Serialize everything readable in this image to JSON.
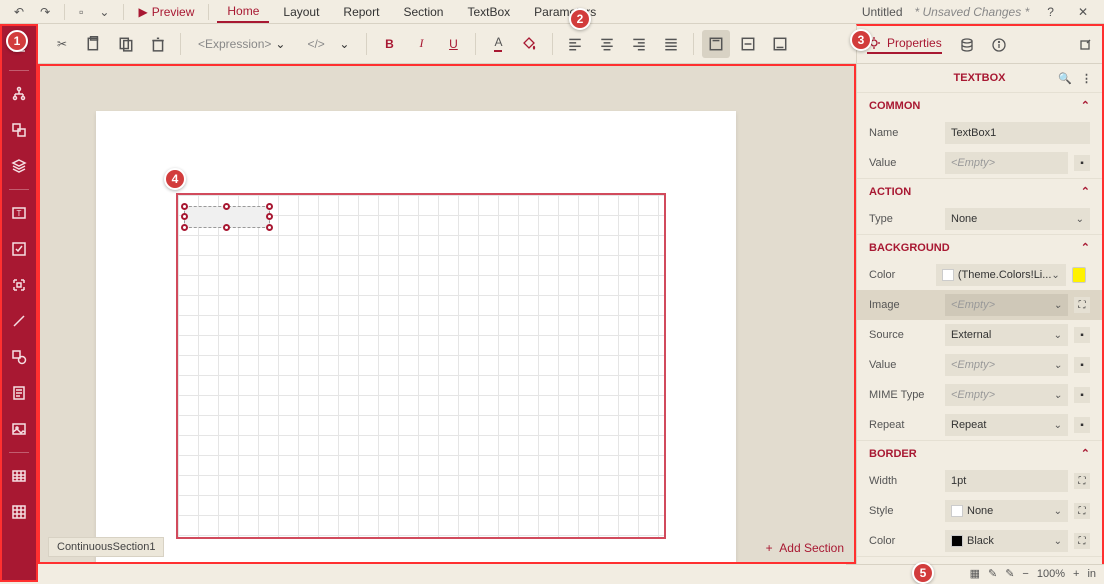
{
  "menubar": {
    "preview": "Preview",
    "tabs": [
      "Home",
      "Layout",
      "Report",
      "Section",
      "TextBox",
      "Parameters"
    ],
    "activeTab": 0,
    "docTitle": "Untitled",
    "docStatus": "* Unsaved Changes *"
  },
  "toolbar": {
    "expression": "<Expression>",
    "fontSizeField": "</>"
  },
  "main": {
    "sectionTab": "ContinuousSection1",
    "addSection": "Add Section"
  },
  "rightPanel": {
    "propertiesTab": "Properties",
    "header": "TEXTBOX",
    "sections": {
      "common": {
        "title": "COMMON",
        "rows": {
          "name": {
            "label": "Name",
            "value": "TextBox1"
          },
          "value": {
            "label": "Value",
            "placeholder": "<Empty>"
          }
        }
      },
      "action": {
        "title": "ACTION",
        "rows": {
          "type": {
            "label": "Type",
            "value": "None"
          }
        }
      },
      "background": {
        "title": "BACKGROUND",
        "rows": {
          "color": {
            "label": "Color",
            "value": "(Theme.Colors!Li..."
          },
          "image": {
            "label": "Image",
            "placeholder": "<Empty>"
          },
          "source": {
            "label": "Source",
            "value": "External"
          },
          "bgvalue": {
            "label": "Value",
            "placeholder": "<Empty>"
          },
          "mime": {
            "label": "MIME Type",
            "placeholder": "<Empty>"
          },
          "repeat": {
            "label": "Repeat",
            "value": "Repeat"
          }
        }
      },
      "border": {
        "title": "BORDER",
        "rows": {
          "width": {
            "label": "Width",
            "value": "1pt"
          },
          "style": {
            "label": "Style",
            "value": "None"
          },
          "bcolor": {
            "label": "Color",
            "value": "Black"
          }
        }
      }
    }
  },
  "statusbar": {
    "zoom": "100%",
    "unit": "in"
  },
  "callouts": {
    "c1": "1",
    "c2": "2",
    "c3": "3",
    "c4": "4",
    "c5": "5"
  }
}
